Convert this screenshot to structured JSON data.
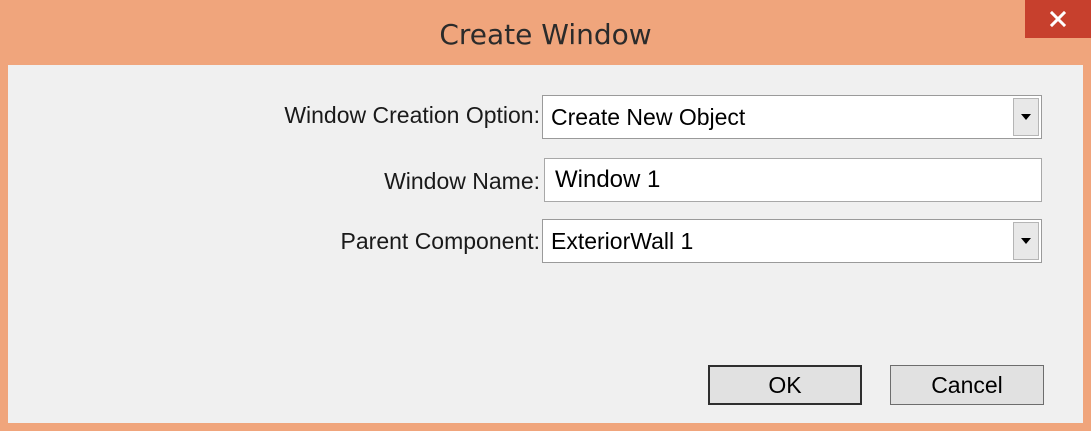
{
  "window": {
    "title": "Create Window"
  },
  "form": {
    "creation_option_label": "Window Creation Option:",
    "creation_option_value": "Create New Object",
    "window_name_label": "Window Name:",
    "window_name_value": "Window 1",
    "parent_component_label": "Parent Component:",
    "parent_component_value": "ExteriorWall 1"
  },
  "buttons": {
    "ok_label": "OK",
    "cancel_label": "Cancel"
  },
  "colors": {
    "titlebar": "#f0a57c",
    "close_button": "#c7402d",
    "client_background": "#f0f0f0"
  },
  "icons": {
    "close": "close-icon",
    "dropdown": "chevron-down-icon"
  }
}
